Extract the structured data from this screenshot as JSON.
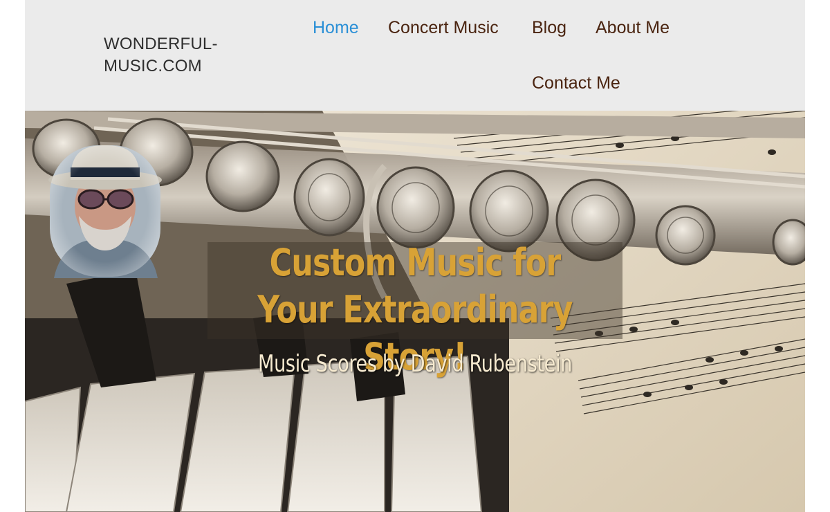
{
  "site": {
    "brand": "WONDERFUL-\nMUSIC.COM"
  },
  "nav": {
    "items": [
      {
        "label": "Home",
        "active": true
      },
      {
        "label": "Concert Music",
        "active": false
      },
      {
        "label": "Blog",
        "active": false
      },
      {
        "label": "About Me",
        "active": false
      },
      {
        "label": "Contact Me",
        "active": false
      }
    ]
  },
  "hero": {
    "title": "Custom Music for Your Extraordinary Story!",
    "subtitle": "Music Scores by David Rubenstein"
  },
  "colors": {
    "header_bg": "#ebebeb",
    "nav_text": "#4a2410",
    "nav_active": "#2a8fd6",
    "title": "#d8a236",
    "subtitle": "#f6ead0"
  }
}
